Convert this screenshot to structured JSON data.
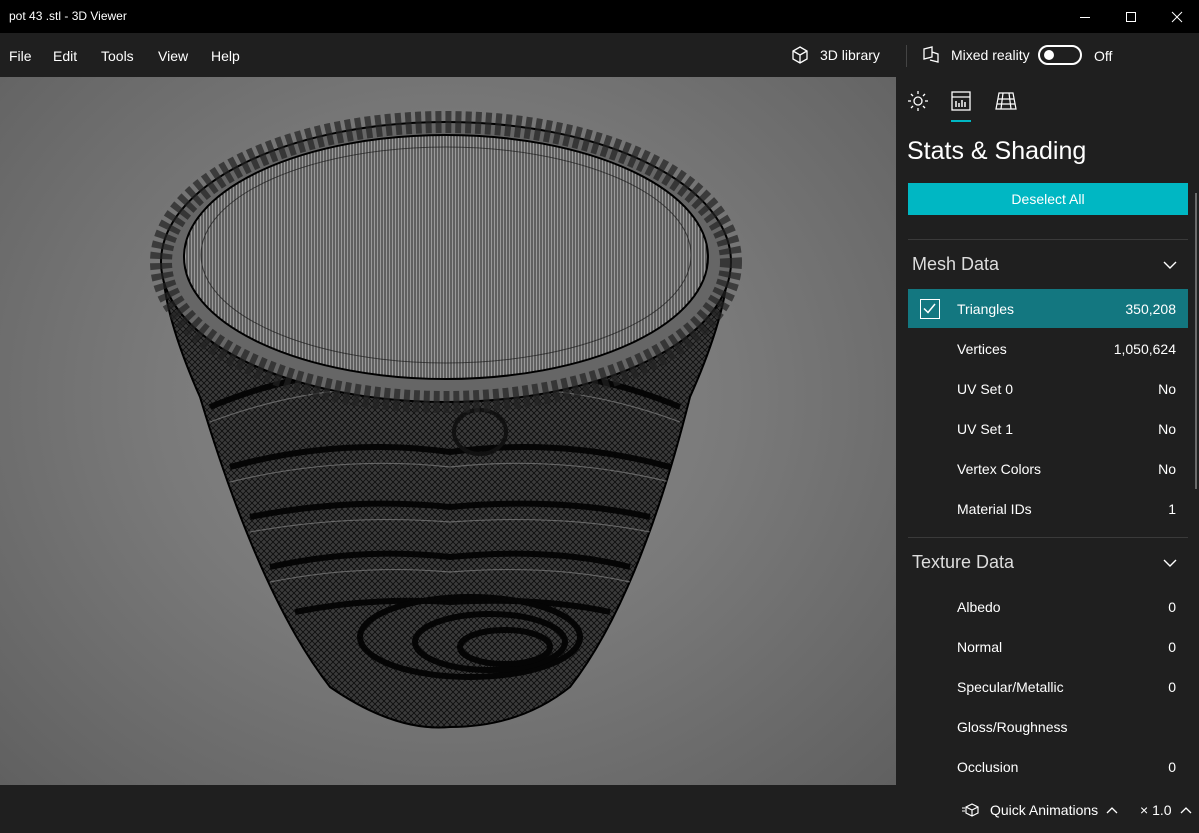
{
  "window": {
    "title": "pot 43 .stl - 3D Viewer"
  },
  "menu": {
    "items": [
      "File",
      "Edit",
      "Tools",
      "View",
      "Help"
    ],
    "library_label": "3D library",
    "mixed_reality_label": "Mixed reality",
    "mixed_reality_state": "Off"
  },
  "panel": {
    "tabs": [
      "lighting-icon",
      "stats-icon",
      "grid-icon"
    ],
    "title": "Stats & Shading",
    "deselect_label": "Deselect All",
    "mesh_section": "Mesh Data",
    "mesh_rows": [
      {
        "label": "Triangles",
        "value": "350,208",
        "selected": true
      },
      {
        "label": "Vertices",
        "value": "1,050,624"
      },
      {
        "label": "UV Set 0",
        "value": "No"
      },
      {
        "label": "UV Set 1",
        "value": "No"
      },
      {
        "label": "Vertex Colors",
        "value": "No"
      },
      {
        "label": "Material IDs",
        "value": "1"
      }
    ],
    "texture_section": "Texture Data",
    "texture_rows": [
      {
        "label": "Albedo",
        "value": "0"
      },
      {
        "label": "Normal",
        "value": "0"
      },
      {
        "label": "Specular/Metallic",
        "value": "0"
      },
      {
        "label": "Gloss/Roughness",
        "value": ""
      },
      {
        "label": "Occlusion",
        "value": "0"
      }
    ]
  },
  "status": {
    "animations_label": "Quick Animations",
    "speed_label": "× 1.0"
  },
  "colors": {
    "accent": "#00b7c3",
    "selected_row": "#137780",
    "background": "#1f1f1f"
  }
}
